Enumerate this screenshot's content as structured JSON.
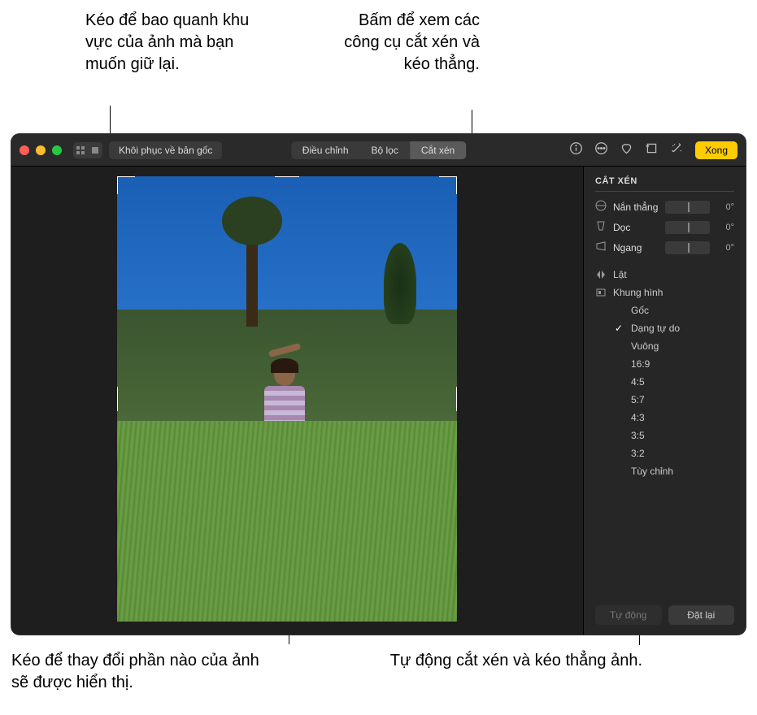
{
  "callouts": {
    "topLeft": "Kéo để bao quanh khu vực của ảnh mà bạn muốn giữ lại.",
    "topRight": "Bấm để xem các công cụ cắt xén và kéo thẳng.",
    "bottomLeft": "Kéo để thay đổi phần nào của ảnh sẽ được hiển thị.",
    "bottomRight": "Tự động cắt xén và kéo thẳng ảnh."
  },
  "toolbar": {
    "revert": "Khôi phục về bản gốc",
    "tabs": {
      "adjust": "Điều chỉnh",
      "filter": "Bộ lọc",
      "crop": "Cắt xén"
    },
    "done": "Xong"
  },
  "sidebar": {
    "title": "CẮT XÉN",
    "sliders": {
      "straighten": {
        "label": "Nắn thẳng",
        "value": "0°"
      },
      "vertical": {
        "label": "Dọc",
        "value": "0°"
      },
      "horizontal": {
        "label": "Ngang",
        "value": "0°"
      }
    },
    "flip": "Lật",
    "frame": "Khung hình",
    "aspects": {
      "original": "Gốc",
      "freeform": "Dạng tự do",
      "square": "Vuông",
      "r169": "16:9",
      "r45": "4:5",
      "r57": "5:7",
      "r43": "4:3",
      "r35": "3:5",
      "r32": "3:2",
      "custom": "Tùy chỉnh"
    },
    "auto": "Tự động",
    "reset": "Đặt lại"
  }
}
